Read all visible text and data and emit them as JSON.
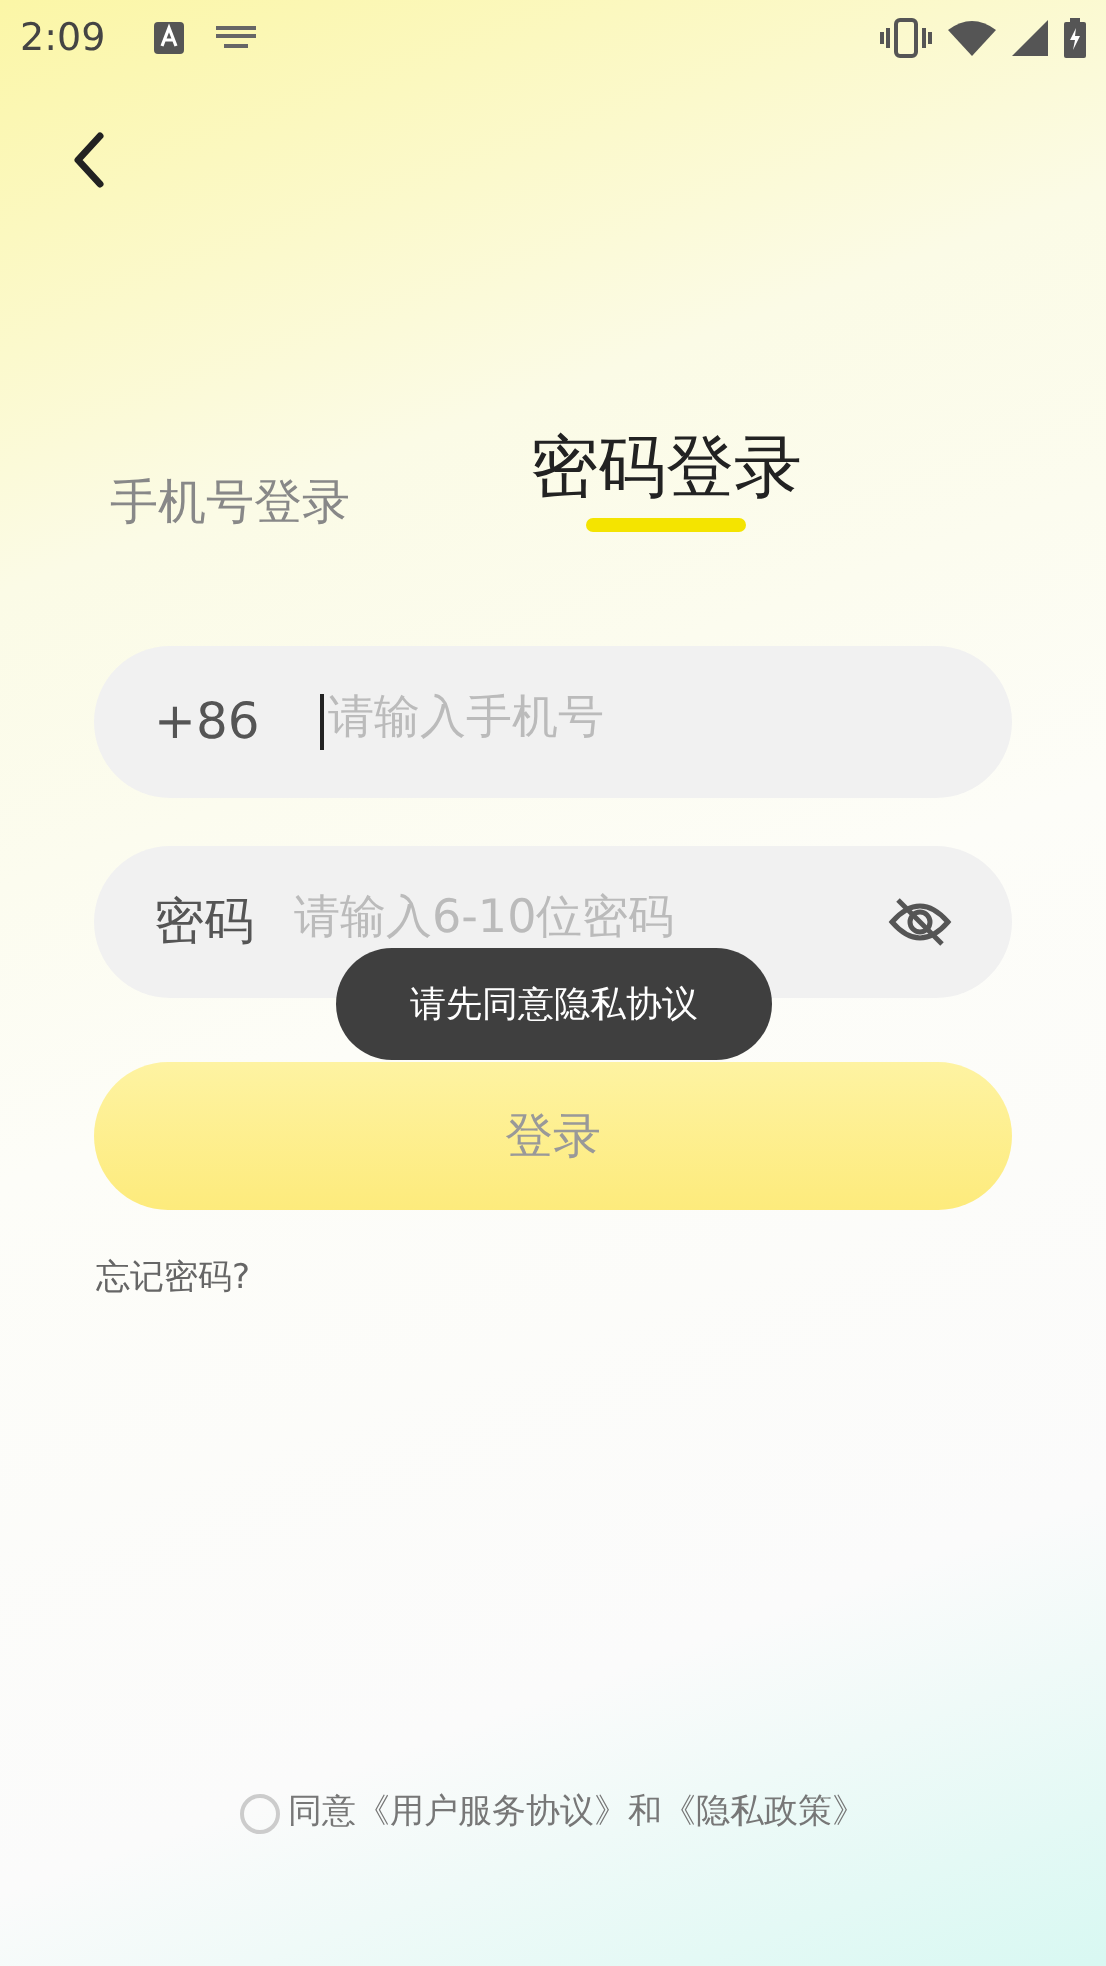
{
  "status_bar": {
    "time": "2:09"
  },
  "tabs": [
    {
      "label": "手机号登录",
      "selected": false
    },
    {
      "label": "密码登录",
      "selected": true
    }
  ],
  "phone_field": {
    "prefix": "+86",
    "placeholder": "请输入手机号",
    "focused": true
  },
  "password_field": {
    "label": "密码",
    "placeholder": "请输入6-10位密码"
  },
  "login_button": {
    "label": "登录",
    "disabled": true
  },
  "forgot_link": "忘记密码?",
  "toast": "请先同意隐私协议",
  "agreement": {
    "checked": false,
    "prefix": "同意",
    "link_1": "《用户服务协议》",
    "joiner": "和",
    "link_2": "《隐私政策》"
  }
}
